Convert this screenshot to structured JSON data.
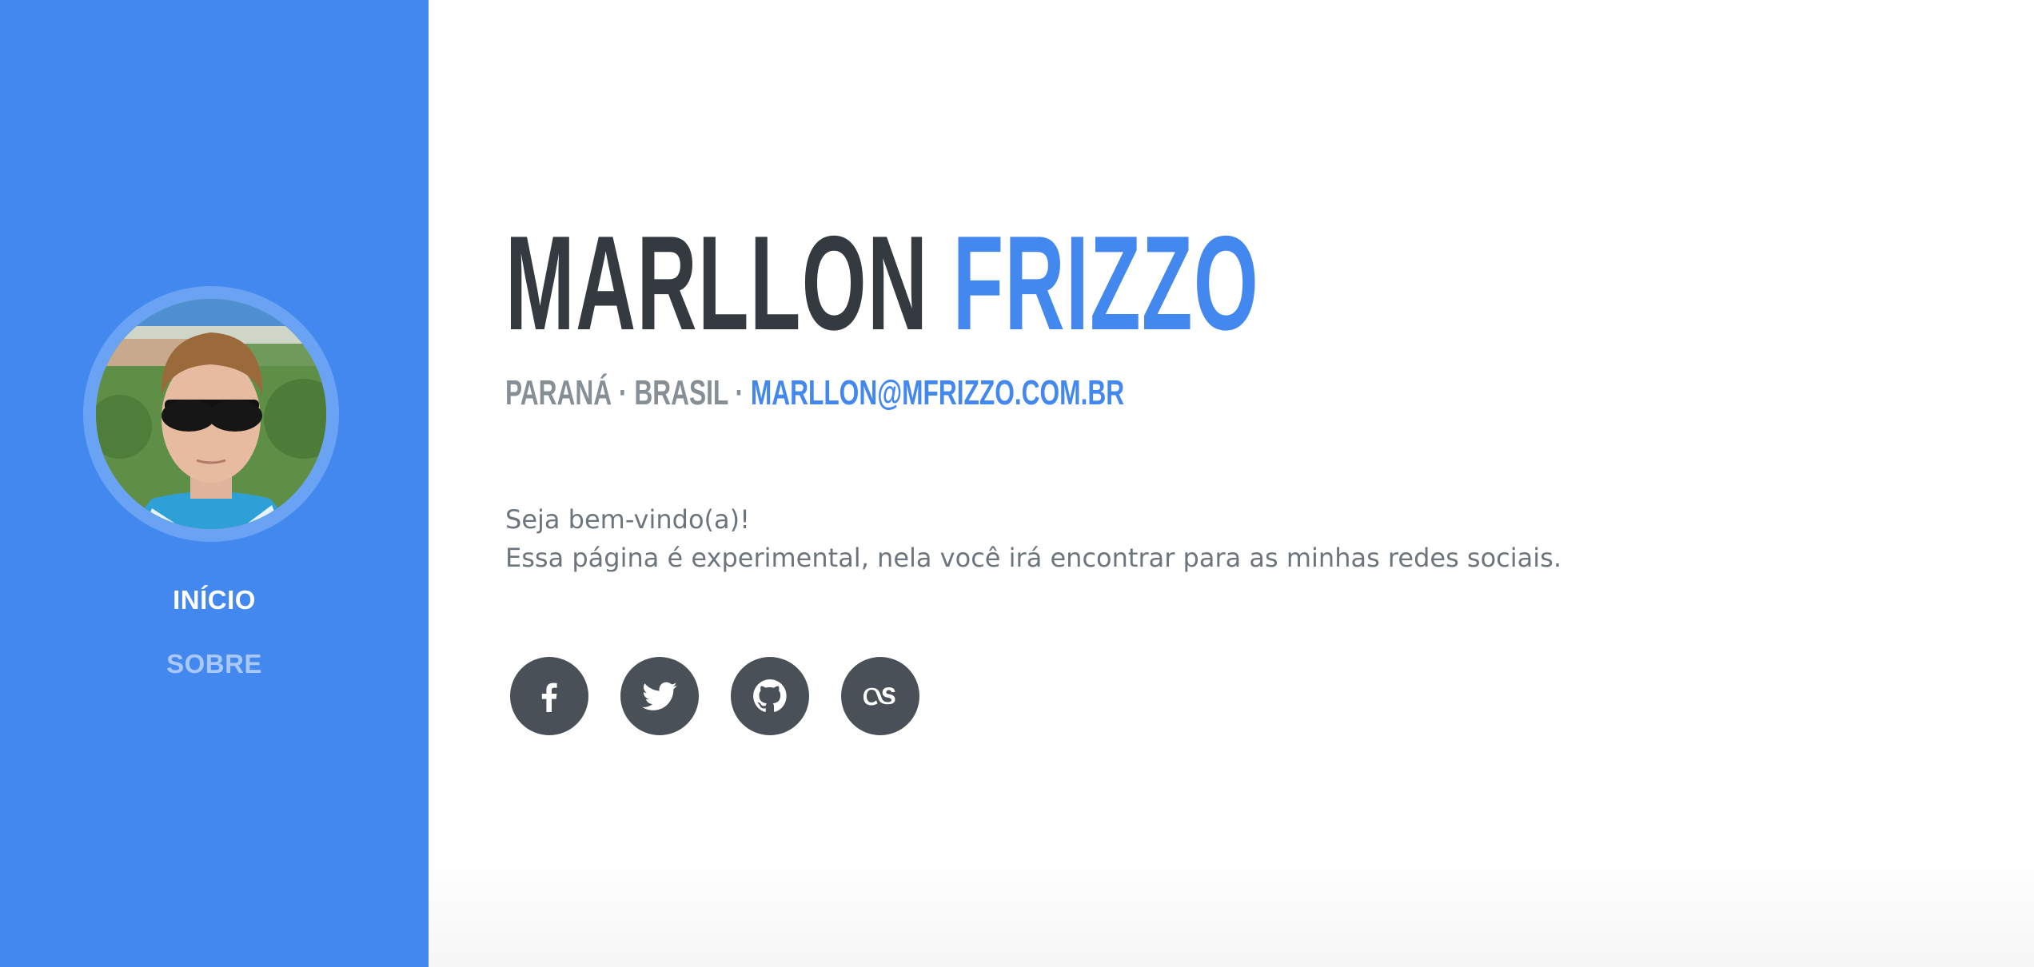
{
  "sidebar": {
    "avatar_alt": "Marllon Frizzo",
    "nav": {
      "home_label": "INÍCIO",
      "about_label": "SOBRE"
    },
    "colors": {
      "background": "#4388ee",
      "avatar_ring": "#6aa3f3",
      "active_link": "#ffffff",
      "inactive_link": "#a9c8f7"
    }
  },
  "main": {
    "name_first": "MARLLON",
    "name_last": "FRIZZO",
    "location": "PARANÁ · BRASIL ·",
    "email": "MARLLON@MFRIZZO.COM.BR",
    "lead_line1": "Seja bem-vindo(a)!",
    "lead_line2": "Essa página é experimental, nela você irá encontrar para as minhas redes sociais.",
    "social_icons": [
      "facebook-icon",
      "twitter-icon",
      "github-icon",
      "lastfm-icon"
    ],
    "colors": {
      "heading_dark": "#343a40",
      "accent": "#4388ee",
      "muted": "#868e96",
      "social_bg": "#495057"
    }
  }
}
